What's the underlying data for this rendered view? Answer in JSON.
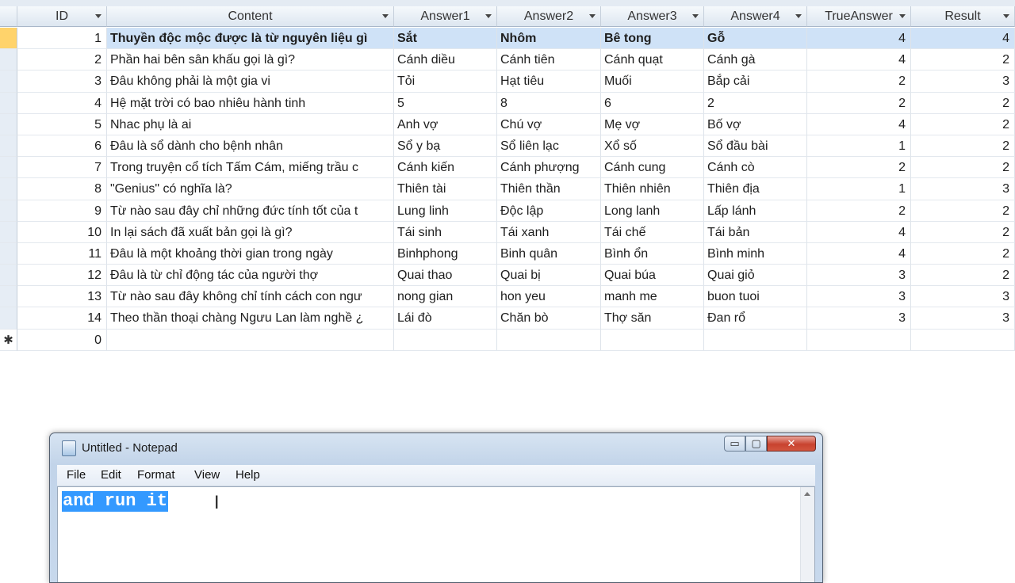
{
  "datasheet": {
    "columns": [
      {
        "label": "ID"
      },
      {
        "label": "Content"
      },
      {
        "label": "Answer1"
      },
      {
        "label": "Answer2"
      },
      {
        "label": "Answer3"
      },
      {
        "label": "Answer4"
      },
      {
        "label": "TrueAnswer"
      },
      {
        "label": "Result"
      }
    ],
    "rows": [
      {
        "id": "1",
        "content": "Thuyền độc mộc được là từ nguyên liệu gì",
        "a1": "Sắt",
        "a2": "Nhôm",
        "a3": "Bê tong",
        "a4": "Gỗ",
        "true": "4",
        "result": "4"
      },
      {
        "id": "2",
        "content": "Phần hai bên sân khấu gọi là gì?",
        "a1": "Cánh diều",
        "a2": "Cánh tiên",
        "a3": "Cánh quạt",
        "a4": "Cánh gà",
        "true": "4",
        "result": "2"
      },
      {
        "id": "3",
        "content": "Đâu không phải là một gia vi",
        "a1": "Tỏi",
        "a2": "Hạt tiêu",
        "a3": "Muối",
        "a4": "Bắp cải",
        "true": "2",
        "result": "3"
      },
      {
        "id": "4",
        "content": "Hệ mặt trời có bao nhiêu hành tinh",
        "a1": "5",
        "a2": "8",
        "a3": "6",
        "a4": "2",
        "true": "2",
        "result": "2"
      },
      {
        "id": "5",
        "content": "Nhac phụ là ai",
        "a1": "Anh vợ",
        "a2": "Chú vợ",
        "a3": "Mẹ vợ",
        "a4": "Bố vợ",
        "true": "4",
        "result": "2"
      },
      {
        "id": "6",
        "content": "Đâu là sổ dành cho bệnh nhân",
        "a1": "Sổ y bạ",
        "a2": "Sổ liên lạc",
        "a3": "Xổ số",
        "a4": "Sổ đầu bài",
        "true": "1",
        "result": "2"
      },
      {
        "id": "7",
        "content": "Trong truyện cổ tích Tấm Cám, miếng trầu c",
        "a1": "Cánh kiến",
        "a2": "Cánh phượng",
        "a3": "Cánh cung",
        "a4": "Cánh cò",
        "true": "2",
        "result": "2"
      },
      {
        "id": "8",
        "content": "\"Genius\" có nghĩa là?",
        "a1": "Thiên tài",
        "a2": "Thiên thần",
        "a3": "Thiên nhiên",
        "a4": "Thiên địa",
        "true": "1",
        "result": "3"
      },
      {
        "id": "9",
        "content": "Từ nào sau đây chỉ những đức tính tốt của t",
        "a1": "Lung linh",
        "a2": "Độc lập",
        "a3": "Long lanh",
        "a4": "Lấp lánh",
        "true": "2",
        "result": "2"
      },
      {
        "id": "10",
        "content": "In lại sách đã xuất bản gọi là gì?",
        "a1": "Tái sinh",
        "a2": "Tái xanh",
        "a3": "Tái chế",
        "a4": "Tái bản",
        "true": "4",
        "result": "2"
      },
      {
        "id": "11",
        "content": "Đâu là một khoảng thời gian trong ngày",
        "a1": "Binhphong",
        "a2": "Binh quân",
        "a3": "Bình ổn",
        "a4": "Bình minh",
        "true": "4",
        "result": "2"
      },
      {
        "id": "12",
        "content": "Đâu là từ chỉ động tác của người thợ",
        "a1": "Quai thao",
        "a2": "Quai bị",
        "a3": "Quai búa",
        "a4": "Quai giỏ",
        "true": "3",
        "result": "2"
      },
      {
        "id": "13",
        "content": "Từ nào sau đây không chỉ tính cách con ngư",
        "a1": "nong gian",
        "a2": "hon yeu",
        "a3": "manh me",
        "a4": "buon tuoi",
        "true": "3",
        "result": "3"
      },
      {
        "id": "14",
        "content": "Theo thần thoại chàng Ngưu Lan làm nghề ¿",
        "a1": "Lái đò",
        "a2": "Chăn bò",
        "a3": "Thợ săn",
        "a4": "Đan rổ",
        "true": "3",
        "result": "3"
      }
    ],
    "new_row": {
      "marker": "✱",
      "id": "0"
    }
  },
  "notepad": {
    "title": "Untitled - Notepad",
    "menu": [
      "File",
      "Edit",
      "Format",
      "View",
      "Help"
    ],
    "text": "and run it",
    "buttons": {
      "minimize": "▭",
      "maximize": "▢",
      "close": "✕"
    }
  },
  "colors": {
    "selected_row": "#cfe2f7",
    "text_selection": "#3399ff",
    "close_button": "#c8432f"
  }
}
